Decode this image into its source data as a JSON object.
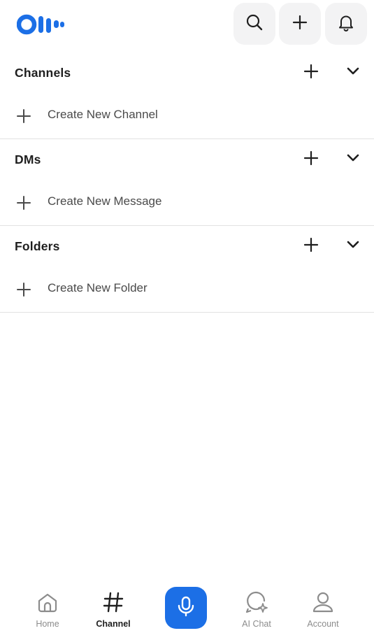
{
  "header": {
    "logo_icon": "otter-logo-icon",
    "buttons": [
      {
        "icon": "search-icon"
      },
      {
        "icon": "plus-icon"
      },
      {
        "icon": "bell-icon"
      }
    ]
  },
  "sections": [
    {
      "title": "Channels",
      "row_label": "Create New Channel"
    },
    {
      "title": "DMs",
      "row_label": "Create New Message"
    },
    {
      "title": "Folders",
      "row_label": "Create New Folder"
    }
  ],
  "bottom_nav": {
    "home": "Home",
    "channel": "Channel",
    "ai_chat": "AI Chat",
    "account": "Account",
    "active": "channel"
  },
  "colors": {
    "accent": "#1c6fe6",
    "text": "#1f1f1f",
    "muted": "#8c8c8c",
    "header_button_bg": "#f3f3f4",
    "divider": "#e2e2e2"
  }
}
